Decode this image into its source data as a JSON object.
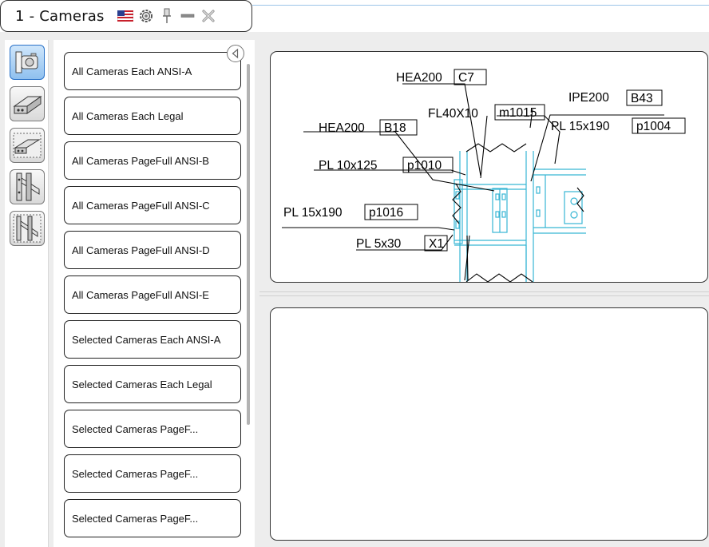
{
  "window": {
    "title": "1 - Cameras",
    "icons": [
      "us-flag-icon",
      "settings-icon",
      "pin-icon",
      "minimize-icon",
      "close-icon"
    ]
  },
  "sidebar": {
    "buttons": [
      {
        "name": "cameras-icon",
        "active": true
      },
      {
        "name": "beam-icon",
        "active": false
      },
      {
        "name": "plate-icon",
        "active": false
      },
      {
        "name": "frame-icon",
        "active": false
      },
      {
        "name": "bracing-icon",
        "active": false
      }
    ]
  },
  "report_list": {
    "items": [
      {
        "label": "All Cameras Each ANSI-A"
      },
      {
        "label": "All Cameras Each Legal"
      },
      {
        "label": "All Cameras PageFull ANSI-B"
      },
      {
        "label": "All Cameras PageFull ANSI-C"
      },
      {
        "label": "All Cameras PageFull ANSI-D"
      },
      {
        "label": "All Cameras PageFull ANSI-E"
      },
      {
        "label": "Selected Cameras Each ANSI-A"
      },
      {
        "label": "Selected Cameras Each Legal"
      },
      {
        "label": "Selected Cameras PageF..."
      },
      {
        "label": "Selected Cameras PageF..."
      },
      {
        "label": "Selected Cameras PageF..."
      }
    ]
  },
  "preview": {
    "labels": [
      {
        "text": "HEA200",
        "tag": "C7"
      },
      {
        "text": "FL40X10",
        "tag": "m1015"
      },
      {
        "text": "IPE200",
        "tag": "B43"
      },
      {
        "text": "HEA200",
        "tag": "B18"
      },
      {
        "text": "PL 15x190",
        "tag": "p1004"
      },
      {
        "text": "PL 10x125",
        "tag": "p1010"
      },
      {
        "text": "PL 15x190",
        "tag": "p1016"
      },
      {
        "text": "PL 5x30",
        "tag": "X1"
      }
    ]
  },
  "colors": {
    "accent_blue": "#2a72c8",
    "drawing_cyan": "#37b6d4",
    "panel_bg": "#ededed"
  }
}
